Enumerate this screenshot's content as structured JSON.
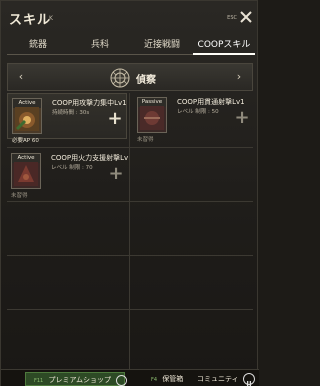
{
  "window": {
    "title": "スキル",
    "hotkey": "K",
    "esc_label": "ESC"
  },
  "tabs": [
    {
      "label": "銃器",
      "active": false
    },
    {
      "label": "兵科",
      "active": false
    },
    {
      "label": "近接戦闘",
      "active": false
    },
    {
      "label": "COOPスキル",
      "active": true
    }
  ],
  "category": {
    "title": "偵察",
    "prev_icon": "chevron-left-icon",
    "next_icon": "chevron-right-icon",
    "emblem_icon": "recon-emblem-icon"
  },
  "skills": [
    {
      "badge": "Active",
      "name": "COOP用攻撃力集中Lv1",
      "sub": "持続時間 : 30s",
      "req": "必要AP 60",
      "plus_icon": "plus-icon",
      "learned": false
    },
    {
      "badge": "Passive",
      "name": "COOP用貫通射撃Lv1",
      "sub": "レベル 制限 : 50",
      "req": "未習得",
      "plus_icon": "plus-icon",
      "learned": false
    },
    {
      "badge": "Active",
      "name": "COOP用火力支援射撃Lv",
      "sub": "レベル 制限 : 70",
      "req": "未習得",
      "plus_icon": "plus-icon",
      "learned": false
    }
  ],
  "footer": {
    "shop_key": "F11",
    "shop_label": "プレミアムショップ",
    "inv_key": "F4",
    "inv_label": "保管箱",
    "comm_label": "コミュニティ"
  },
  "colors": {
    "accent_green": "#4e7a3d",
    "tab_active": "#fffef8"
  }
}
